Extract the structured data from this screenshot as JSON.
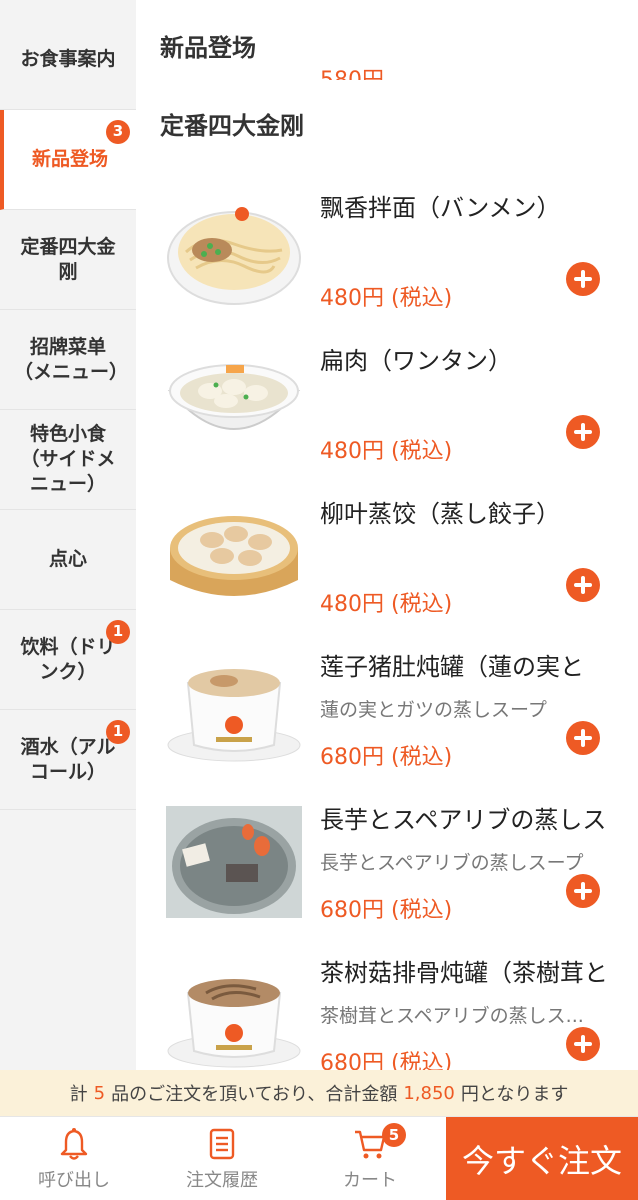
{
  "sidebar": {
    "items": [
      {
        "label": "お食事案内",
        "badge": ""
      },
      {
        "label": "新品登场",
        "badge": "3"
      },
      {
        "label": "定番四大金刚",
        "badge": ""
      },
      {
        "label": "招牌菜单（メニュー）",
        "badge": ""
      },
      {
        "label": "特色小食（サイドメニュー）",
        "badge": ""
      },
      {
        "label": "点心",
        "badge": ""
      },
      {
        "label": "饮料（ドリンク）",
        "badge": "1"
      },
      {
        "label": "酒水（アルコール）",
        "badge": "1"
      }
    ],
    "active_index": 1
  },
  "main": {
    "section_top": "新品登场",
    "section_current": "定番四大金刚",
    "items": [
      {
        "name": "飘香拌面（バンメン）",
        "desc": "",
        "price": "480円 (税込)",
        "image": "noodle-bowl"
      },
      {
        "name": "扁肉（ワンタン）",
        "desc": "",
        "price": "480円 (税込)",
        "image": "wonton-soup"
      },
      {
        "name": "柳叶蒸饺（蒸し餃子）",
        "desc": "",
        "price": "480円 (税込)",
        "image": "steamed-dumplings"
      },
      {
        "name": "莲子猪肚炖罐（蓮の実と",
        "desc": "蓮の実とガツの蒸しスープ",
        "price": "680円 (税込)",
        "image": "soup-pot"
      },
      {
        "name": "長芋とスペアリブの蒸しス",
        "desc": "長芋とスペアリブの蒸しスープ",
        "price": "680円 (税込)",
        "image": "yam-rib-soup"
      },
      {
        "name": "茶树菇排骨炖罐（茶樹茸と",
        "desc": "茶樹茸とスペアリブの蒸しス...",
        "price": "680円 (税込)",
        "image": "mushroom-soup-pot"
      }
    ]
  },
  "summary": {
    "prefix": "計",
    "count": "5",
    "mid": "品のご注文を頂いており、合計金額",
    "amount": "1,850",
    "suffix": "円となります"
  },
  "bottom_nav": {
    "call_label": "呼び出し",
    "history_label": "注文履歴",
    "cart_label": "カート",
    "cart_badge": "5",
    "order_label": "今すぐ注文"
  },
  "colors": {
    "accent": "#ee5a24",
    "summary_bg": "#fbf1d9",
    "sidebar_bg": "#f3f3f3"
  }
}
